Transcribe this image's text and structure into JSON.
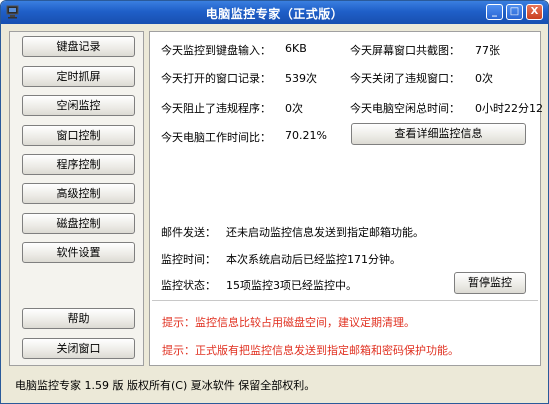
{
  "window": {
    "title": "电脑监控专家（正式版）"
  },
  "titlebar_buttons": {
    "minimize": "_",
    "restore": "□",
    "close": "X"
  },
  "sidebar": {
    "top_items": [
      {
        "label": "键盘记录"
      },
      {
        "label": "定时抓屏"
      },
      {
        "label": "空闲监控"
      },
      {
        "label": "窗口控制"
      },
      {
        "label": "程序控制"
      },
      {
        "label": "高级控制"
      },
      {
        "label": "磁盘控制"
      },
      {
        "label": "软件设置"
      }
    ],
    "help_label": "帮助",
    "close_label": "关闭窗口"
  },
  "stats": {
    "keyboard_label": "今天监控到键盘输入：",
    "keyboard_value": "6KB",
    "screenshots_label": "今天屏幕窗口共截图：",
    "screenshots_value": "77张",
    "windows_opened_label": "今天打开的窗口记录：",
    "windows_opened_value": "539次",
    "violations_closed_label": "今天关闭了违规窗口：",
    "violations_closed_value": "0次",
    "blocked_label": "今天阻止了违规程序：",
    "blocked_value": "0次",
    "idle_label": "今天电脑空闲总时间：",
    "idle_value": "0小时22分12",
    "work_ratio_label": "今天电脑工作时间比：",
    "work_ratio_value": "70.21%",
    "details_button": "查看详细监控信息"
  },
  "info": {
    "email_label": "邮件发送：",
    "email_value": "还未启动监控信息发送到指定邮箱功能。",
    "time_label": "监控时间：",
    "time_value": "本次系统启动后已经监控171分钟。",
    "status_label": "监控状态：",
    "status_value": "15项监控3项已经监控中。",
    "pause_button": "暂停监控"
  },
  "hints": [
    "提示：监控信息比较占用磁盘空间，建议定期清理。",
    "提示：正式版有把监控信息发送到指定邮箱和密码保护功能。"
  ],
  "statusbar": {
    "text": "电脑监控专家  1.59 版  版权所有(C)  夏冰软件  保留全部权利。"
  },
  "colors": {
    "titlebar": "#1f5fc8",
    "hint_red": "#e03020",
    "window_bg": "#ece9d8"
  }
}
